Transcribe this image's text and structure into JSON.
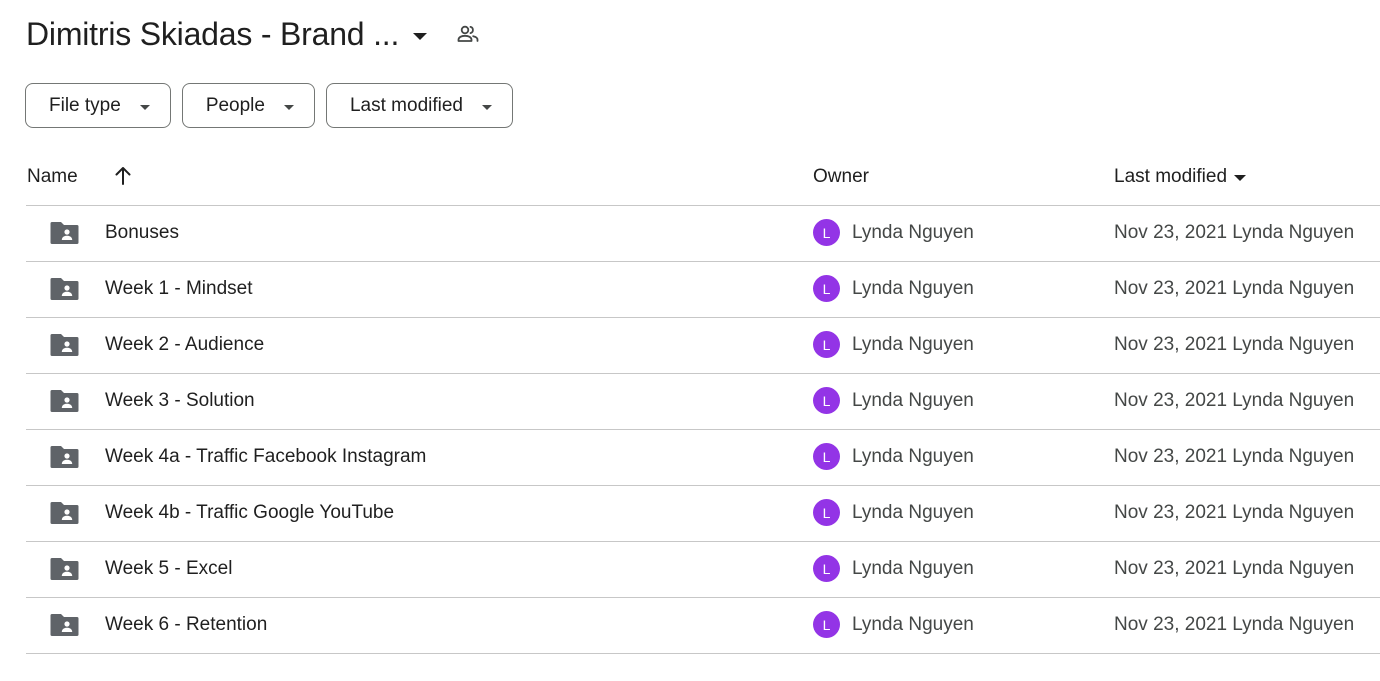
{
  "header": {
    "folder_title": "Dimitris Skiadas - Brand ...",
    "caret_icon": "arrow-drop-down-icon",
    "shared_icon": "people-icon"
  },
  "filters": {
    "file_type": "File type",
    "people": "People",
    "last_modified": "Last modified"
  },
  "table": {
    "columns": {
      "name": "Name",
      "owner": "Owner",
      "last_modified": "Last modified"
    },
    "sort_icon": "arrow-upward-icon",
    "rows": [
      {
        "name": "Bonuses",
        "owner_initial": "L",
        "owner": "Lynda Nguyen",
        "modified": "Nov 23, 2021 Lynda Nguyen"
      },
      {
        "name": "Week 1 - Mindset",
        "owner_initial": "L",
        "owner": "Lynda Nguyen",
        "modified": "Nov 23, 2021 Lynda Nguyen"
      },
      {
        "name": "Week 2 - Audience",
        "owner_initial": "L",
        "owner": "Lynda Nguyen",
        "modified": "Nov 23, 2021 Lynda Nguyen"
      },
      {
        "name": "Week 3 - Solution",
        "owner_initial": "L",
        "owner": "Lynda Nguyen",
        "modified": "Nov 23, 2021 Lynda Nguyen"
      },
      {
        "name": "Week 4a - Traffic Facebook Instagram",
        "owner_initial": "L",
        "owner": "Lynda Nguyen",
        "modified": "Nov 23, 2021 Lynda Nguyen"
      },
      {
        "name": "Week 4b - Traffic Google YouTube",
        "owner_initial": "L",
        "owner": "Lynda Nguyen",
        "modified": "Nov 23, 2021 Lynda Nguyen"
      },
      {
        "name": "Week 5 - Excel",
        "owner_initial": "L",
        "owner": "Lynda Nguyen",
        "modified": "Nov 23, 2021 Lynda Nguyen"
      },
      {
        "name": "Week 6 - Retention",
        "owner_initial": "L",
        "owner": "Lynda Nguyen",
        "modified": "Nov 23, 2021 Lynda Nguyen"
      }
    ]
  },
  "colors": {
    "avatar": "#9334e6",
    "folder_icon": "#5f6368",
    "divider": "#c7c7c7"
  }
}
